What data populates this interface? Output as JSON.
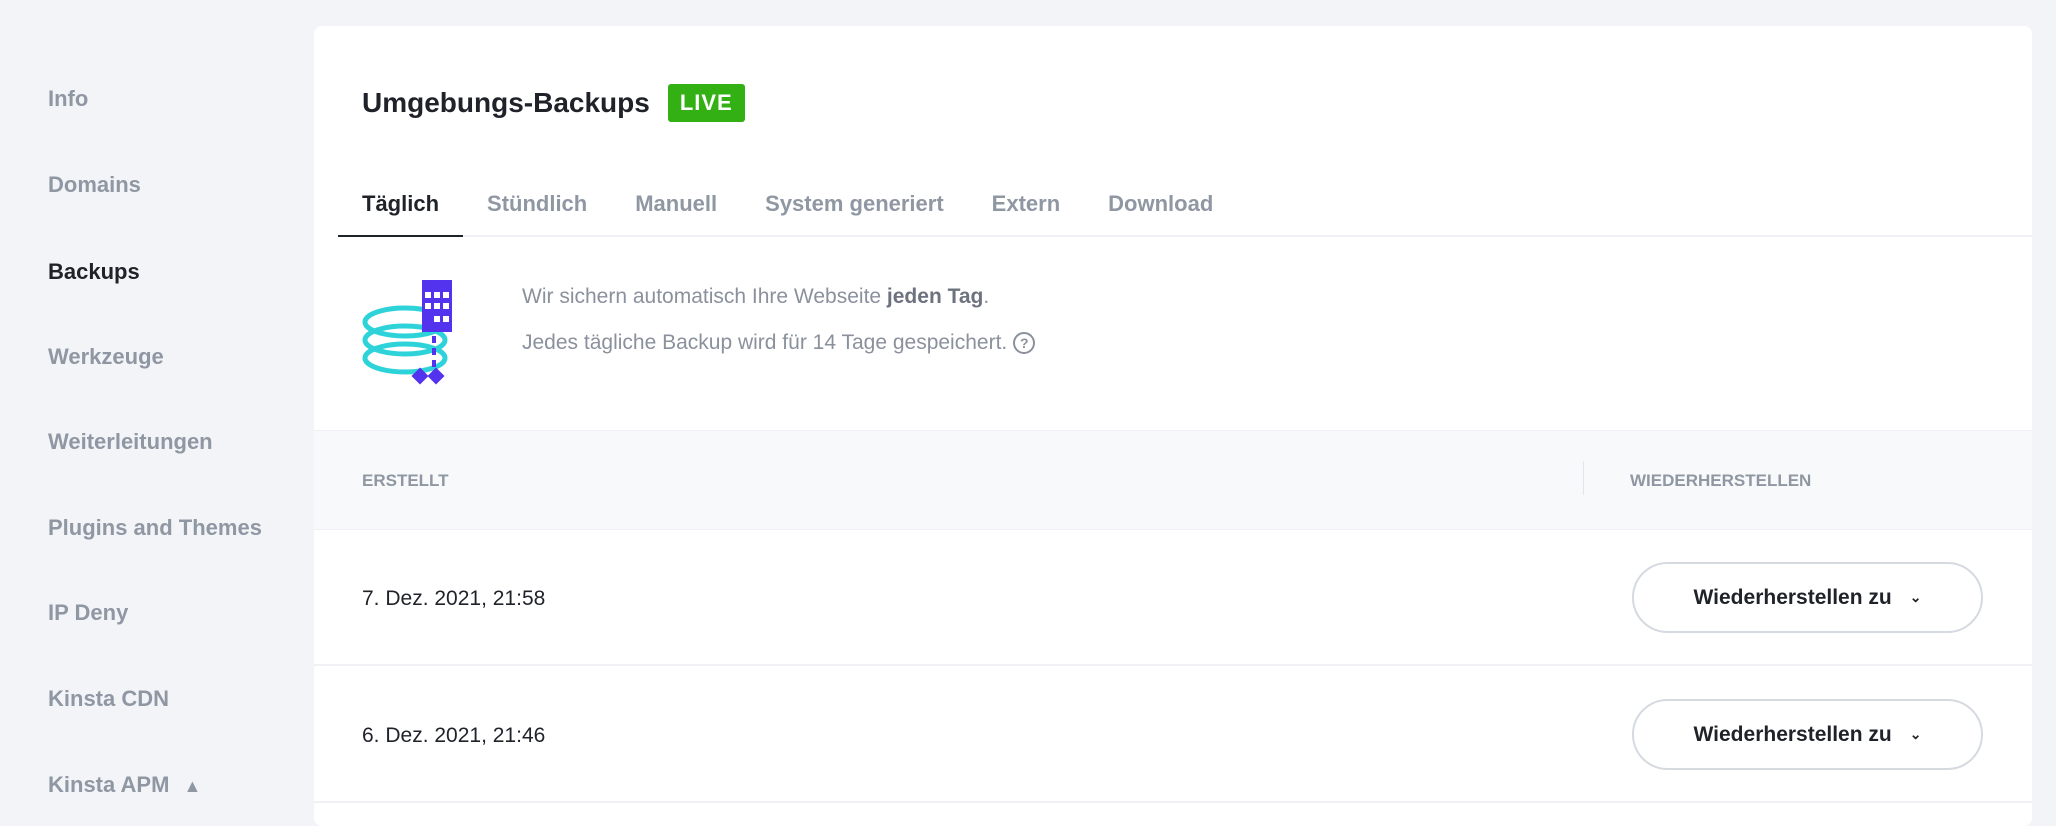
{
  "sidebar": {
    "items": [
      {
        "label": "Info"
      },
      {
        "label": "Domains"
      },
      {
        "label": "Backups"
      },
      {
        "label": "Werkzeuge"
      },
      {
        "label": "Weiterleitungen"
      },
      {
        "label": "Plugins and Themes"
      },
      {
        "label": "IP Deny"
      },
      {
        "label": "Kinsta CDN"
      },
      {
        "label": "Kinsta APM"
      }
    ]
  },
  "header": {
    "title": "Umgebungs-Backups",
    "badge": "LIVE"
  },
  "tabs": [
    {
      "label": "Täglich"
    },
    {
      "label": "Stündlich"
    },
    {
      "label": "Manuell"
    },
    {
      "label": "System generiert"
    },
    {
      "label": "Extern"
    },
    {
      "label": "Download"
    }
  ],
  "info": {
    "line1_prefix": "Wir sichern automatisch Ihre Webseite ",
    "line1_bold": "jeden Tag",
    "line1_suffix": ".",
    "line2": "Jedes tägliche Backup wird für 14 Tage gespeichert.",
    "help": "?"
  },
  "table": {
    "columns": [
      "ERSTELLT",
      "WIEDERHERSTELLEN"
    ],
    "rows": [
      {
        "date": "7. Dez. 2021, 21:58",
        "action": "Wiederherstellen zu"
      },
      {
        "date": "6. Dez. 2021, 21:46",
        "action": "Wiederherstellen zu"
      }
    ]
  },
  "colors": {
    "live": "#33b014",
    "accent": "#5333ed",
    "teal": "#2ed3d9"
  }
}
